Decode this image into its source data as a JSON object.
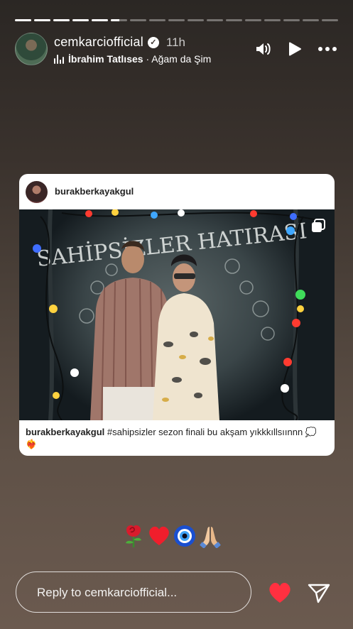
{
  "progress": {
    "segments": 17,
    "completed": 5,
    "current_fraction": 0.5
  },
  "header": {
    "username": "cemkarciofficial",
    "time_ago": "11h",
    "music": {
      "artist": "İbrahim Tatlıses",
      "separator": " · ",
      "song": "Ağam da Şim"
    }
  },
  "post": {
    "username": "burakberkayakgul",
    "caption_user": "burakberkayakgul",
    "caption_text": " #sahipsizler sezon finali bu akşam yıkkkıllsıınnn 💭❤️‍🔥",
    "photo_sign_text": "SAHİPSİZLER HATIRASI"
  },
  "emojis": [
    "rose",
    "red-heart",
    "nazar-amulet",
    "folded-hands"
  ],
  "reply": {
    "placeholder": "Reply to cemkarciofficial..."
  },
  "colors": {
    "like": "#ff3040",
    "text": "#ffffff",
    "card_bg": "#ffffff"
  }
}
